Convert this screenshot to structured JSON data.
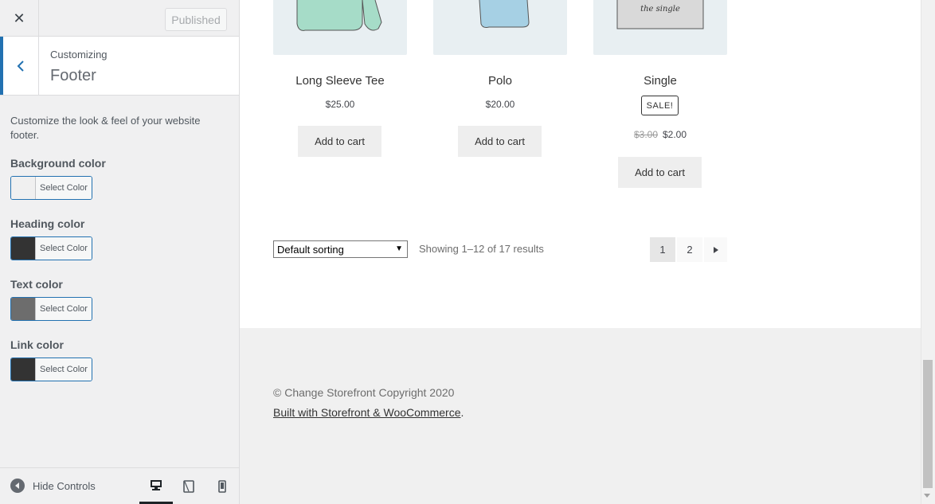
{
  "panel": {
    "close_icon": "close-icon",
    "publish_label": "Published",
    "back_icon": "chevron-left-icon",
    "customizing_label": "Customizing",
    "section_title": "Footer",
    "description": "Customize the look & feel of your website footer.",
    "controls": [
      {
        "label": "Background color",
        "button": "Select Color",
        "swatch": "#f0f0f0"
      },
      {
        "label": "Heading color",
        "button": "Select Color",
        "swatch": "#333333"
      },
      {
        "label": "Text color",
        "button": "Select Color",
        "swatch": "#6d6d6d"
      },
      {
        "label": "Link color",
        "button": "Select Color",
        "swatch": "#333333"
      }
    ],
    "footer": {
      "hide_label": "Hide Controls",
      "devices": [
        "desktop-icon",
        "tablet-icon",
        "mobile-icon"
      ],
      "active_device": "desktop"
    }
  },
  "products": [
    {
      "name": "Long Sleeve Tee",
      "price": "$25.00",
      "button": "Add to cart"
    },
    {
      "name": "Polo",
      "price": "$20.00",
      "button": "Add to cart"
    },
    {
      "name": "Single",
      "badge": "SALE!",
      "old_price": "$3.00",
      "price": "$2.00",
      "button": "Add to cart",
      "image_text": "the single"
    }
  ],
  "shop": {
    "sorting": "Default sorting",
    "result_count": "Showing 1–12 of 17 results",
    "pages": [
      "1",
      "2"
    ],
    "current_page": "1"
  },
  "site_footer": {
    "copyright": "© Change Storefront Copyright 2020",
    "built_with": "Built with Storefront & WooCommerce",
    "built_with_suffix": "."
  }
}
